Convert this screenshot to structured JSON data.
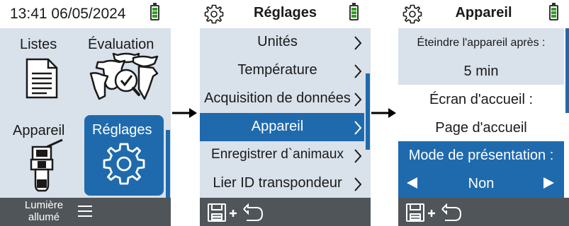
{
  "screen_main": {
    "datetime": "13:41 06/05/2024",
    "tiles": [
      {
        "label": "Listes",
        "icon": "document-list-icon"
      },
      {
        "label": "Évaluation",
        "icon": "livestock-check-icon"
      },
      {
        "label": "Appareil",
        "icon": "handheld-device-icon"
      },
      {
        "label": "Réglages",
        "icon": "gear-icon",
        "selected": true
      }
    ],
    "bottom": {
      "light_label": "Lumière allumé",
      "menu_icon": "hamburger-menu-icon"
    }
  },
  "screen_settings": {
    "title": "Réglages",
    "items": [
      {
        "label": "Unités"
      },
      {
        "label": "Température"
      },
      {
        "label": "Acquisition de données"
      },
      {
        "label": "Appareil",
        "selected": true
      },
      {
        "label": "Enregistrer d`animaux"
      },
      {
        "label": "Lier ID transpondeur"
      }
    ],
    "bottom_icons": [
      "save-icon",
      "plus-icon",
      "return-arrow-icon"
    ]
  },
  "screen_device": {
    "title": "Appareil",
    "power_off_label": "Éteindre l'appareil après :",
    "power_off_value": "5 min",
    "home_screen_label": "Écran d'accueil :",
    "home_screen_value": "Page d'accueil",
    "demo_mode_label": "Mode de présentation :",
    "demo_mode_value": "Non",
    "bottom_icons": [
      "save-icon",
      "plus-icon",
      "return-arrow-icon"
    ]
  },
  "colors": {
    "accent": "#1f6aad",
    "panel": "#d9e1ea",
    "bottom_bar": "#505559",
    "battery": "#2e9f1f"
  }
}
